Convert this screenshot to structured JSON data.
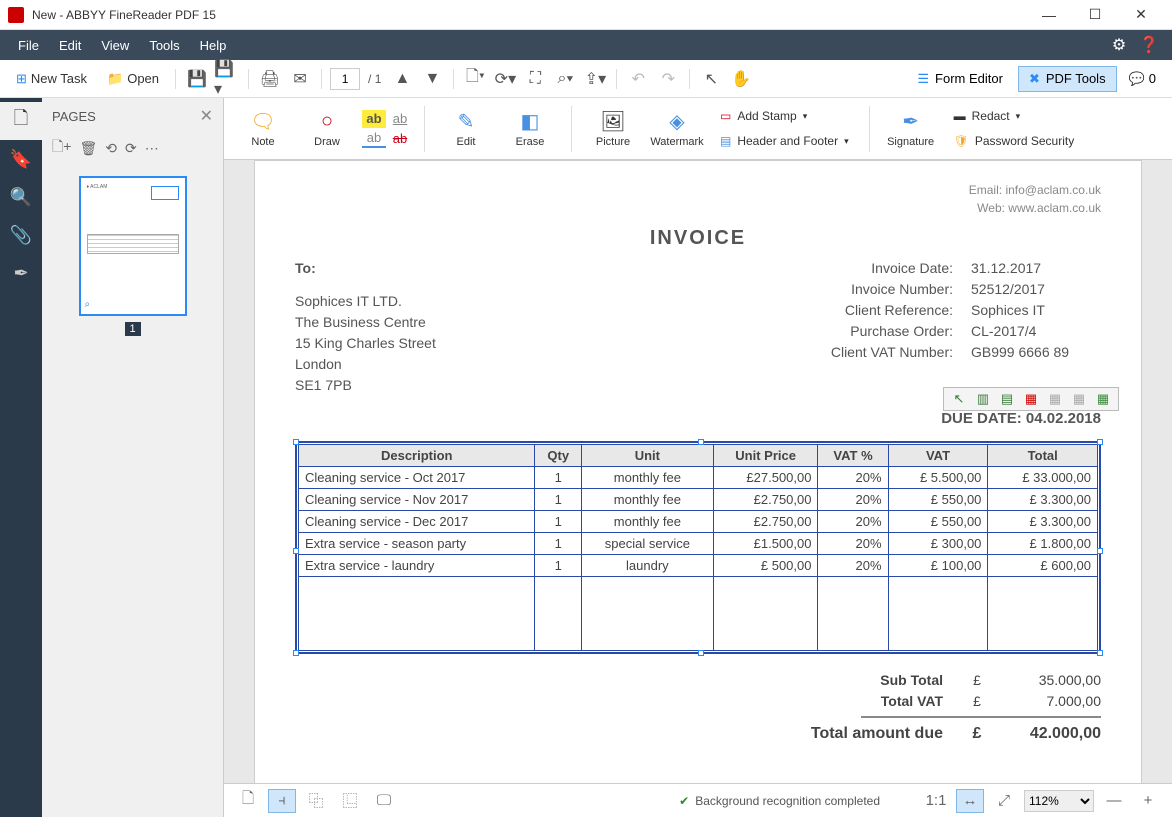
{
  "window": {
    "title": "New - ABBYY FineReader PDF 15"
  },
  "menubar": {
    "items": [
      "File",
      "Edit",
      "View",
      "Tools",
      "Help"
    ]
  },
  "toolbar1": {
    "new_task": "New Task",
    "open": "Open",
    "page_current": "1",
    "page_total": "/ 1",
    "form_editor": "Form Editor",
    "pdf_tools": "PDF Tools",
    "comments": "0"
  },
  "pages_panel": {
    "title": "PAGES",
    "thumb_label": "1"
  },
  "ribbon": {
    "note": "Note",
    "draw": "Draw",
    "edit": "Edit",
    "erase": "Erase",
    "picture": "Picture",
    "watermark": "Watermark",
    "signature": "Signature",
    "add_stamp": "Add Stamp",
    "header_footer": "Header and Footer",
    "redact": "Redact",
    "password": "Password Security"
  },
  "document": {
    "contact": {
      "email_label": "Email:",
      "email": "info@aclam.co.uk",
      "web_label": "Web:",
      "web": "www.aclam.co.uk"
    },
    "invoice_title": "INVOICE",
    "to_label": "To:",
    "to_lines": [
      "Sophices IT LTD.",
      "The Business Centre",
      "15 King Charles Street",
      "London",
      "SE1 7PB"
    ],
    "meta": [
      {
        "label": "Invoice Date:",
        "value": "31.12.2017"
      },
      {
        "label": "Invoice Number:",
        "value": "52512/2017"
      },
      {
        "label": "Client Reference:",
        "value": "Sophices IT"
      },
      {
        "label": "Purchase Order:",
        "value": "CL-2017/4"
      },
      {
        "label": "Client VAT Number:",
        "value": "GB999 6666 89"
      }
    ],
    "due_date": "DUE DATE: 04.02.2018",
    "table": {
      "headers": [
        "Description",
        "Qty",
        "Unit",
        "Unit Price",
        "VAT %",
        "VAT",
        "Total"
      ],
      "rows": [
        [
          "Cleaning service - Oct 2017",
          "1",
          "monthly fee",
          "£27.500,00",
          "20%",
          "£  5.500,00",
          "£    33.000,00"
        ],
        [
          "Cleaning service - Nov 2017",
          "1",
          "monthly fee",
          "£2.750,00",
          "20%",
          "£     550,00",
          "£      3.300,00"
        ],
        [
          "Cleaning service - Dec 2017",
          "1",
          "monthly fee",
          "£2.750,00",
          "20%",
          "£     550,00",
          "£      3.300,00"
        ],
        [
          "Extra service - season party",
          "1",
          "special service",
          "£1.500,00",
          "20%",
          "£     300,00",
          "£      1.800,00"
        ],
        [
          "Extra service - laundry",
          "1",
          "laundry",
          "£     500,00",
          "20%",
          "£     100,00",
          "£         600,00"
        ]
      ]
    },
    "totals": {
      "subtotal_label": "Sub Total",
      "subtotal": "35.000,00",
      "vat_label": "Total VAT",
      "vat": "7.000,00",
      "grand_label": "Total amount due",
      "grand": "42.000,00",
      "currency": "£"
    }
  },
  "statusbar": {
    "status": "Background recognition completed",
    "ratio": "1:1",
    "zoom": "112%"
  }
}
